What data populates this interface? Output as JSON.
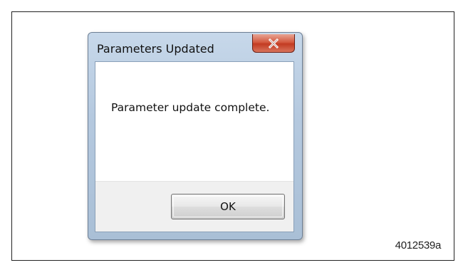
{
  "dialog": {
    "title": "Parameters Updated",
    "message": "Parameter update complete.",
    "ok_label": "OK",
    "close_icon": "close-icon"
  },
  "figure": {
    "id": "4012539a"
  },
  "colors": {
    "window_frame": "#b5c9df",
    "close_button": "#c23b22",
    "button_bar": "#f0f0f0",
    "client_background": "#ffffff"
  }
}
